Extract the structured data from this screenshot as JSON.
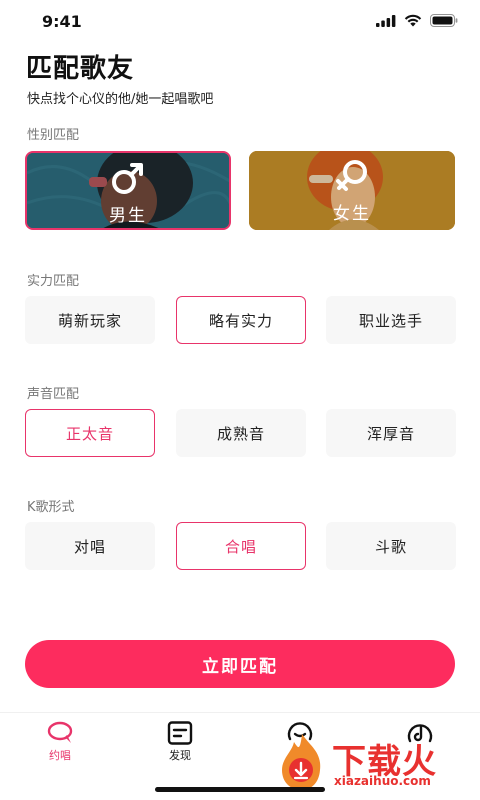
{
  "status_bar": {
    "time": "9:41",
    "icons": [
      "signal-icon",
      "wifi-icon",
      "battery-icon"
    ]
  },
  "header": {
    "title": "匹配歌友",
    "subtitle": "快点找个心仪的他/她一起唱歌吧"
  },
  "gender": {
    "label": "性别匹配",
    "options": [
      {
        "label": "男生",
        "symbol": "male-icon",
        "selected": true
      },
      {
        "label": "女生",
        "symbol": "female-icon",
        "selected": false
      }
    ]
  },
  "skill": {
    "label": "实力匹配",
    "options": [
      {
        "label": "萌新玩家",
        "selected": false
      },
      {
        "label": "略有实力",
        "selected": true
      },
      {
        "label": "职业选手",
        "selected": false
      }
    ]
  },
  "voice": {
    "label": "声音匹配",
    "options": [
      {
        "label": "正太音",
        "selected": true
      },
      {
        "label": "成熟音",
        "selected": false
      },
      {
        "label": "浑厚音",
        "selected": false
      }
    ]
  },
  "mode": {
    "label": "K歌形式",
    "options": [
      {
        "label": "对唱",
        "selected": false
      },
      {
        "label": "合唱",
        "selected": true
      },
      {
        "label": "斗歌",
        "selected": false
      }
    ]
  },
  "match_button": {
    "label": "立即匹配"
  },
  "tab_bar": {
    "items": [
      {
        "label": "约唱",
        "icon": "chat-bubble-icon",
        "active": true
      },
      {
        "label": "发现",
        "icon": "note-icon",
        "active": false
      },
      {
        "label": "",
        "icon": "smile-icon",
        "active": false
      },
      {
        "label": "",
        "icon": "tiktok-icon",
        "active": false
      }
    ]
  },
  "watermark": {
    "text": "下载火",
    "url": "xiazaihuo.com"
  },
  "colors": {
    "accent": "#e8346a",
    "button": "#fd2c5e",
    "watermark": "#e8312f"
  }
}
